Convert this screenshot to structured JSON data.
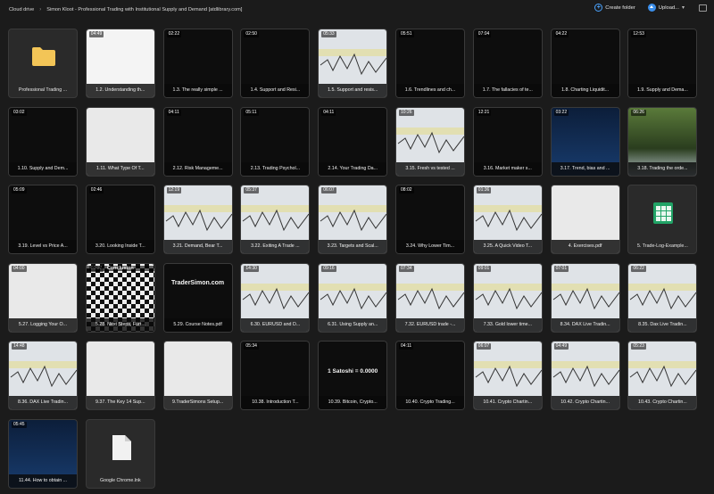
{
  "breadcrumb": {
    "root": "Cloud drive",
    "folder": "Simon Kloot - Professional Trading with Institutional Supply and Demand [atdlibrary.com]"
  },
  "actions": {
    "create_folder": "Create folder",
    "upload": "Upload..."
  },
  "icons": {
    "create_folder": "plus-circle-icon",
    "upload": "upload-arrow-icon",
    "view_toggle": "grid-view-icon"
  },
  "items": [
    {
      "label": "Professional Trading ...",
      "duration": "",
      "kind": "folder"
    },
    {
      "label": "1.2. Understanding th...",
      "duration": "04:49",
      "kind": "white"
    },
    {
      "label": "1.3. The really simple ...",
      "duration": "02:22",
      "kind": "dark"
    },
    {
      "label": "1.4. Support and Resi...",
      "duration": "02:50",
      "kind": "dark"
    },
    {
      "label": "1.5. Support and resis...",
      "duration": "05:33",
      "kind": "chart"
    },
    {
      "label": "1.6. Trendlines and ch...",
      "duration": "05:51",
      "kind": "dark"
    },
    {
      "label": "1.7. The fallacies of te...",
      "duration": "07:04",
      "kind": "dark"
    },
    {
      "label": "1.8. Charting Liquidit...",
      "duration": "04:22",
      "kind": "dark"
    },
    {
      "label": "1.9. Supply and Dema...",
      "duration": "12:53",
      "kind": "dark"
    },
    {
      "label": "1.10. Supply and Dem...",
      "duration": "03:02",
      "kind": "dark"
    },
    {
      "label": "1.11. What Type Of T...",
      "duration": "",
      "kind": "doc"
    },
    {
      "label": "2.12. Risk Manageme...",
      "duration": "04:11",
      "kind": "dark"
    },
    {
      "label": "2.13. Trading Psychol...",
      "duration": "05:11",
      "kind": "dark"
    },
    {
      "label": "2.14. Your Trading Da...",
      "duration": "04:11",
      "kind": "dark"
    },
    {
      "label": "3.15. Fresh vs tested ...",
      "duration": "10:26",
      "kind": "chart"
    },
    {
      "label": "3.16. Market maker s...",
      "duration": "12:21",
      "kind": "dark"
    },
    {
      "label": "3.17. Trend, bias and ...",
      "duration": "03:22",
      "kind": "blue"
    },
    {
      "label": "3.18. Trading the orde...",
      "duration": "06:26",
      "kind": "scenic"
    },
    {
      "label": "3.19. Level vs Price A...",
      "duration": "05:09",
      "kind": "dark"
    },
    {
      "label": "3.20. Looking Inside T...",
      "duration": "02:46",
      "kind": "dark"
    },
    {
      "label": "3.21. Demand, Bear T...",
      "duration": "12:19",
      "kind": "chart"
    },
    {
      "label": "3.22. Exiting A Trade ...",
      "duration": "05:37",
      "kind": "chart"
    },
    {
      "label": "3.23. Targets and Scal...",
      "duration": "06:07",
      "kind": "chart"
    },
    {
      "label": "3.24. Why Lower Tim...",
      "duration": "08:02",
      "kind": "dark"
    },
    {
      "label": "3.25. A Quick Video T...",
      "duration": "01:36",
      "kind": "chart"
    },
    {
      "label": "4. Exercises.pdf",
      "duration": "",
      "kind": "doc"
    },
    {
      "label": "5. Trade-Log-Example...",
      "duration": "",
      "kind": "sheet"
    },
    {
      "label": "5.27. Logging Your O...",
      "duration": "04:00",
      "kind": "doc"
    },
    {
      "label": "5.28. Next Steps, Furt...",
      "duration": "02:37",
      "kind": "check"
    },
    {
      "label": "5.29. Course Notes.pdf",
      "duration": "",
      "kind": "dark"
    },
    {
      "label": "6.30. EURUSD and D...",
      "duration": "14:30",
      "kind": "chart"
    },
    {
      "label": "6.31. Using Supply an...",
      "duration": "09:16",
      "kind": "chart"
    },
    {
      "label": "7.32. EURUSD trade -...",
      "duration": "07:34",
      "kind": "chart"
    },
    {
      "label": "7.33. Gold lower time...",
      "duration": "09:01",
      "kind": "chart"
    },
    {
      "label": "8.34. DAX Live Tradin...",
      "duration": "07:01",
      "kind": "chart"
    },
    {
      "label": "8.35. Dax Live Tradin...",
      "duration": "06:22",
      "kind": "chart"
    },
    {
      "label": "8.36. DAX Live Tradin...",
      "duration": "14:48",
      "kind": "chart"
    },
    {
      "label": "9.37. The Key 14 Sup...",
      "duration": "",
      "kind": "doc"
    },
    {
      "label": "9.TraderSimons Setup...",
      "duration": "",
      "kind": "doc"
    },
    {
      "label": "10.38. Introduction T...",
      "duration": "05:34",
      "kind": "dark"
    },
    {
      "label": "10.39. Bitcoin, Crypto...",
      "duration": "",
      "kind": "dark"
    },
    {
      "label": "10.40. Crypto Trading...",
      "duration": "04:11",
      "kind": "dark"
    },
    {
      "label": "10.41. Crypto Chartin...",
      "duration": "06:07",
      "kind": "chart"
    },
    {
      "label": "10.42. Crypto Chartin...",
      "duration": "04:49",
      "kind": "chart"
    },
    {
      "label": "10.43. Crypto Chartin...",
      "duration": "05:23",
      "kind": "chart"
    },
    {
      "label": "11.44. How to obtain ...",
      "duration": "05:45",
      "kind": "blue"
    },
    {
      "label": "Google Chrome.lnk",
      "duration": "",
      "kind": "file"
    }
  ],
  "overlay_text": {
    "bitcoin": "1 Satoshi = 0.0000",
    "tradersimon": "TraderSimon.com",
    "course_conclusion": "Conclusion"
  }
}
